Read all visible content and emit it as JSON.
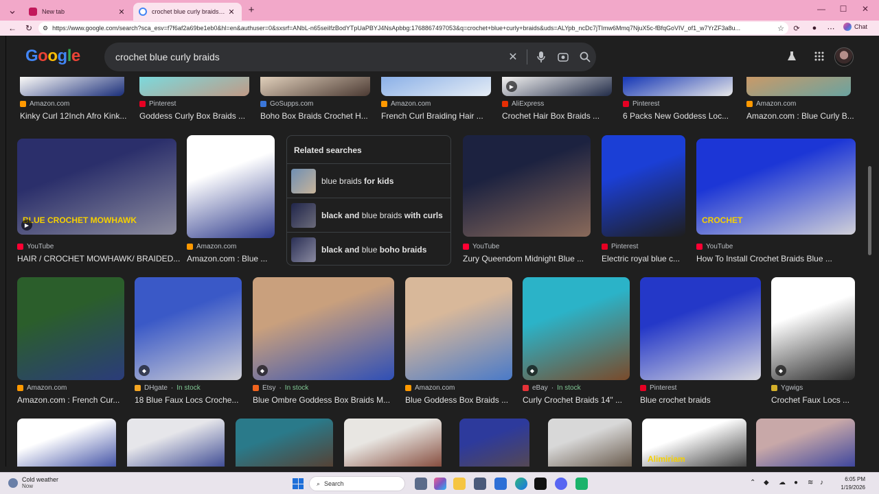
{
  "browser": {
    "tabs": [
      {
        "title": "New tab",
        "active": false
      },
      {
        "title": "crochet blue curly braids - Google",
        "active": true
      }
    ],
    "url": "https://www.google.com/search?sca_esv=f7f6af2a69be1eb0&hl=en&authuser=0&sxsrf=ANbL-n65seiIfzBodYTpUaPBYJ4NsApbbg:1768867497053&q=crochet+blue+curly+braids&uds=ALYpb_ncDc7jTImw6Mmq7NjuX5c-fBfqGoVIV_of1_w7YrZF3a8u...",
    "chat_label": "Chat"
  },
  "google": {
    "logo_letters": [
      "G",
      "o",
      "o",
      "g",
      "l",
      "e"
    ],
    "query": "crochet blue curly braids"
  },
  "row1": [
    {
      "source": "Amazon.com",
      "title": "Kinky Curl 12Inch Afro Kink...",
      "fav": "#ff9900",
      "c1": "#f3f3f3",
      "c2": "#1b2f7a"
    },
    {
      "source": "Pinterest",
      "title": "Goddess Curly Box Braids ...",
      "fav": "#e60023",
      "c1": "#7fd6d8",
      "c2": "#c09a86"
    },
    {
      "source": "GoSupps.com",
      "title": "Boho Box Braids Crochet H...",
      "fav": "#3a76d8",
      "c1": "#d9c8b4",
      "c2": "#4b3a33"
    },
    {
      "source": "Amazon.com",
      "title": "French Curl Braiding Hair ...",
      "fav": "#ff9900",
      "c1": "#8fb3e8",
      "c2": "#e6edf5"
    },
    {
      "source": "AliExpress",
      "title": "Crochet Hair Box Braids ...",
      "fav": "#e62e04",
      "c1": "#e9e9e9",
      "c2": "#222c48"
    },
    {
      "source": "Pinterest",
      "title": "6 Packs New Goddess Loc...",
      "fav": "#e60023",
      "c1": "#1f3fb8",
      "c2": "#e8e8e8"
    },
    {
      "source": "Amazon.com",
      "title": "Amazon.com : Blue Curly B...",
      "fav": "#ff9900",
      "c1": "#c69a6a",
      "c2": "#6aa3a0"
    }
  ],
  "row2": [
    {
      "source": "YouTube",
      "title": "HAIR / CROCHET MOWHAWK/ BRAIDED...",
      "fav": "#ff0033",
      "c1": "#2b2f6b",
      "c2": "#8c8c9e",
      "overlay": "BLUE CROCHET MOWHAWK"
    },
    {
      "source": "Amazon.com",
      "title": "Amazon.com : Blue ...",
      "fav": "#ff9900",
      "c1": "#ffffff",
      "c2": "#2d3a8c"
    },
    {
      "source": "YouTube",
      "title": "Zury Queendom Midnight Blue ...",
      "fav": "#ff0033",
      "c1": "#1c2240",
      "c2": "#8a6a5a"
    },
    {
      "source": "Pinterest",
      "title": "Electric royal blue c...",
      "fav": "#e60023",
      "c1": "#1b3fd6",
      "c2": "#1e1e1e"
    },
    {
      "source": "YouTube",
      "title": "How To Install Crochet Braids Blue ...",
      "fav": "#ff0033",
      "c1": "#1c36d6",
      "c2": "#d0d0d8",
      "overlay": "CROCHET"
    }
  ],
  "related": {
    "heading": "Related searches",
    "items": [
      {
        "plain": "blue braids ",
        "bold": "for kids",
        "c1": "#6f8fb3",
        "c2": "#c8b49a"
      },
      {
        "plain": "black and blue braids ",
        "bold": "with curls",
        "c1": "#20254a",
        "c2": "#6b6b7a",
        "bold_first": true,
        "first": "black and",
        "mid": " blue braids ",
        "last": "with curls"
      },
      {
        "plain": "black and blue boho braids",
        "bold": "",
        "c1": "#2a2f55",
        "c2": "#8a8aa0",
        "bold_first": true,
        "first": "black and",
        "mid": " blue ",
        "last": "boho braids"
      }
    ]
  },
  "row3": [
    {
      "source": "Amazon.com",
      "stock": "",
      "title": "Amazon.com : French Cur...",
      "fav": "#ff9900",
      "c1": "#2b5e2b",
      "c2": "#2b3c7a"
    },
    {
      "source": "DHgate",
      "stock": "In stock",
      "title": "18 Blue Faux Locs Croche...",
      "fav": "#f5a623",
      "c1": "#3a59c7",
      "c2": "#cfcfd6"
    },
    {
      "source": "Etsy",
      "stock": "In stock",
      "title": "Blue Ombre Goddess Box Braids M...",
      "fav": "#f1641e",
      "c1": "#c9a07d",
      "c2": "#2f4fb6"
    },
    {
      "source": "Amazon.com",
      "stock": "",
      "title": "Blue Goddess Box Braids ...",
      "fav": "#ff9900",
      "c1": "#d8b89a",
      "c2": "#4a7ac8"
    },
    {
      "source": "eBay",
      "stock": "In stock",
      "title": "Curly Crochet Braids 14\" ...",
      "fav": "#e53238",
      "c1": "#2bb3c8",
      "c2": "#7a4a2a"
    },
    {
      "source": "Pinterest",
      "stock": "",
      "title": "Blue crochet braids",
      "fav": "#e60023",
      "c1": "#2438c8",
      "c2": "#d8d8e0"
    },
    {
      "source": "Ygwigs",
      "stock": "",
      "title": "Crochet Faux Locs ...",
      "fav": "#d4b02a",
      "c1": "#ffffff",
      "c2": "#2a2a2a"
    }
  ],
  "row4": [
    {
      "c1": "#ffffff",
      "c2": "#2d3f9c"
    },
    {
      "c1": "#e6e6ea",
      "c2": "#2b3a8a"
    },
    {
      "c1": "#2a7a8a",
      "c2": "#5a3a2a"
    },
    {
      "c1": "#e8e6e2",
      "c2": "#7a3a2a"
    },
    {
      "c1": "#2d3a9c",
      "c2": "#5a4a4a"
    },
    {
      "c1": "#d8d8d8",
      "c2": "#5a4a3a"
    },
    {
      "c1": "#ffffff",
      "c2": "#2a2a2a",
      "overlay": "Alimiriam"
    },
    {
      "c1": "#c8a8a8",
      "c2": "#2d3a9c"
    }
  ],
  "taskbar": {
    "weather_title": "Cold weather",
    "weather_sub": "Now",
    "search_label": "Search",
    "time": "6:05 PM",
    "date": "1/19/2026"
  }
}
